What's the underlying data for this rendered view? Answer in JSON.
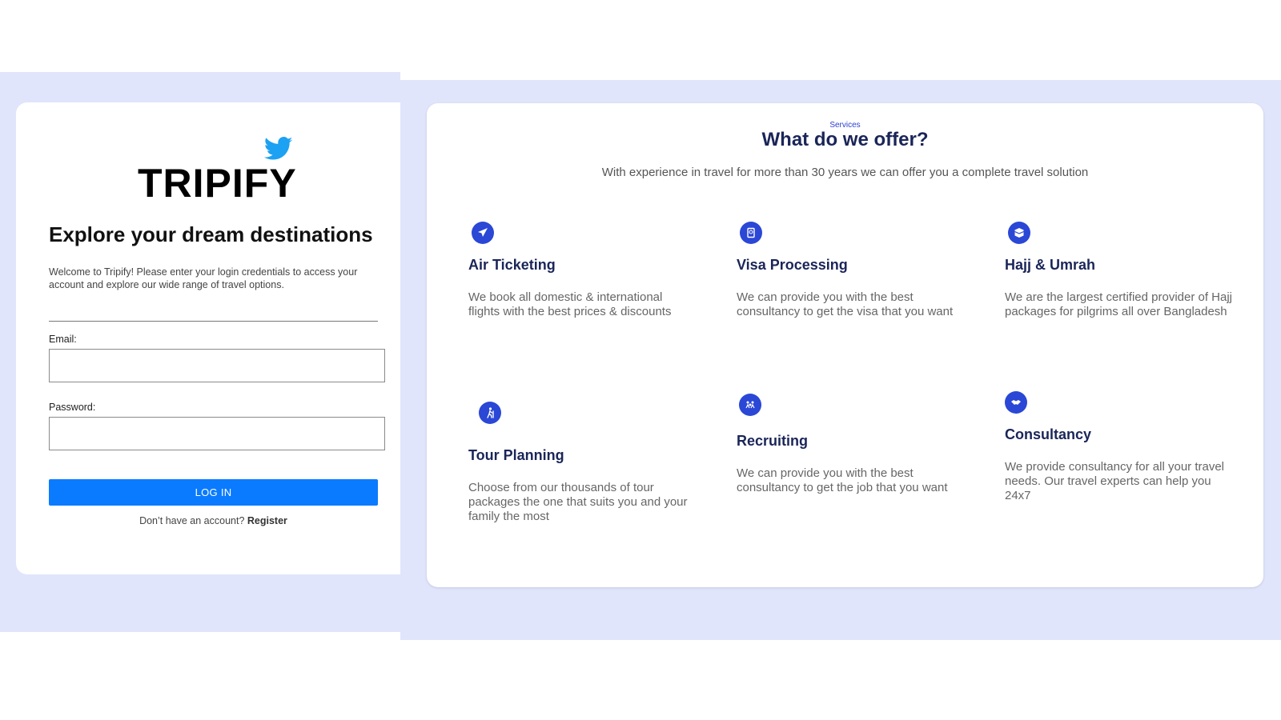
{
  "login": {
    "brand": "TRIPIFY",
    "heading": "Explore your dream destinations",
    "description": "Welcome to Tripify! Please enter your login credentials to access your account and explore our wide range of travel options.",
    "email_label": "Email:",
    "email_value": "",
    "password_label": "Password:",
    "password_value": "",
    "button_label": "LOG IN",
    "register_prompt": "Don’t have an account?",
    "register_link": "Register"
  },
  "services": {
    "eyebrow": "Services",
    "title": "What do we offer?",
    "subtitle": "With experience in travel for more than 30 years we can offer you a complete travel solution",
    "items": [
      {
        "icon": "airplane-icon",
        "name": "Air Ticketing",
        "description": "We book all domestic & international flights with the best prices & discounts"
      },
      {
        "icon": "passport-icon",
        "name": "Visa Processing",
        "description": "We can provide you with the best consultancy to get the visa that you want"
      },
      {
        "icon": "kaaba-icon",
        "name": "Hajj & Umrah",
        "description": "We are the largest certified provider of Hajj packages for pilgrims all over Bangladesh"
      },
      {
        "icon": "hiker-icon",
        "name": "Tour Planning",
        "description": "Choose from our thousands of tour packages the one that suits you and your family the most"
      },
      {
        "icon": "people-group-icon",
        "name": "Recruiting",
        "description": "We can provide you with the best consultancy to get the job that you want"
      },
      {
        "icon": "handshake-icon",
        "name": "Consultancy",
        "description": "We provide consultancy for all your travel needs. Our travel experts can help you 24x7"
      }
    ]
  },
  "colors": {
    "backdrop": "#e0e5fc",
    "button": "#0a7bff",
    "icon_bg": "#2a47d6",
    "heading_navy": "#1a2558",
    "bird": "#1da1f2"
  }
}
